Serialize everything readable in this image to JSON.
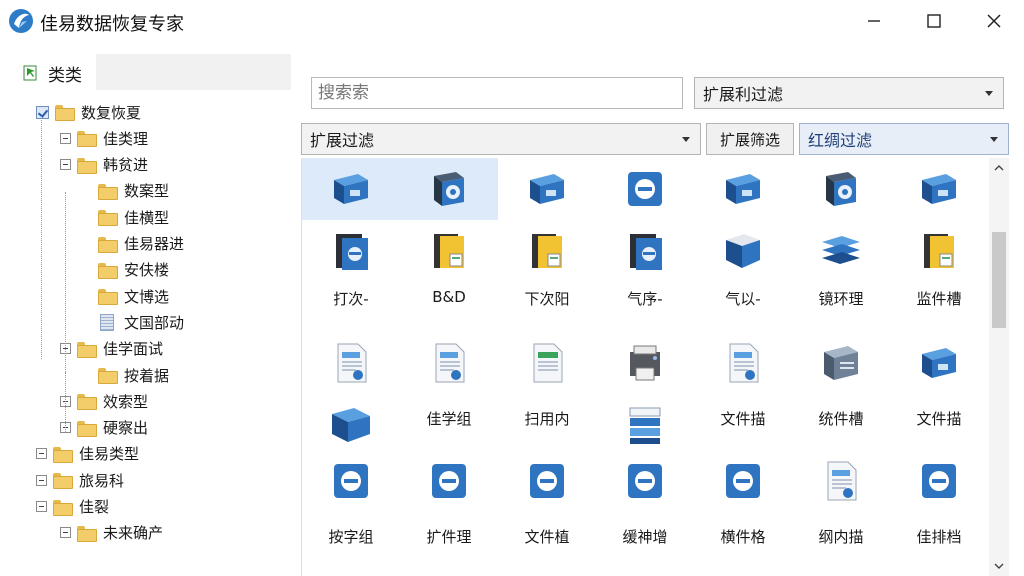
{
  "window": {
    "title": "佳易数据恢复专家",
    "icon": "app-logo-icon"
  },
  "sidebar": {
    "header": "类类",
    "tree": [
      {
        "label": "数复恢夏",
        "level": 0,
        "kind": "folder"
      },
      {
        "label": "佳类理",
        "level": 1,
        "kind": "folder"
      },
      {
        "label": "韩贫进",
        "level": 1,
        "kind": "folder"
      },
      {
        "label": "数案型",
        "level": 2,
        "kind": "folder"
      },
      {
        "label": "佳横型",
        "level": 2,
        "kind": "folder"
      },
      {
        "label": "佳易器进",
        "level": 2,
        "kind": "folder"
      },
      {
        "label": "安伕楼",
        "level": 2,
        "kind": "folder"
      },
      {
        "label": "文博选",
        "level": 2,
        "kind": "folder"
      },
      {
        "label": "文国部动",
        "level": 2,
        "kind": "doc"
      },
      {
        "label": "佳学面试",
        "level": 1,
        "kind": "folder"
      },
      {
        "label": "按着据",
        "level": 2,
        "kind": "folder"
      },
      {
        "label": "效索型",
        "level": 1,
        "kind": "folder"
      },
      {
        "label": "硬察出",
        "level": 1,
        "kind": "folder"
      },
      {
        "label": "佳易类型",
        "level": 0,
        "kind": "folder"
      },
      {
        "label": "旅易科",
        "level": 0,
        "kind": "folder"
      },
      {
        "label": "佳裂",
        "level": 0,
        "kind": "folder"
      },
      {
        "label": "未来确产",
        "level": 1,
        "kind": "folder"
      }
    ]
  },
  "toolbar": {
    "search_placeholder": "搜索索",
    "ext_filter_label": "扩展利过滤",
    "filter_label": "扩展过滤",
    "ext_button_label": "扩展筛选",
    "red_filter_label": "红绸过滤"
  },
  "grid": {
    "rows": [
      {
        "labels": [
          "",
          "",
          "",
          "",
          "",
          "",
          ""
        ],
        "icons": [
          "box",
          "box-disk",
          "box",
          "disc-blue",
          "box",
          "box-disk",
          "box"
        ]
      },
      {
        "labels": [
          "打次-",
          "B&D",
          "下次阳",
          "气序-",
          "气以-",
          "镜环理",
          "监件槽"
        ],
        "icons": [
          "box-dark",
          "box-yellow",
          "box-yellow",
          "box-dark",
          "box-open",
          "stack",
          "box-yellow"
        ]
      },
      {
        "labels": [
          "",
          "",
          "",
          "",
          "",
          "",
          ""
        ],
        "icons": [
          "doc-page",
          "doc-page",
          "doc-green",
          "printer",
          "doc-page",
          "box-lined",
          "box"
        ]
      },
      {
        "labels": [
          "",
          "佳学组",
          "扫用内",
          "",
          "文件描",
          "统件槽",
          "文件描"
        ],
        "icons": [
          "box-open2",
          "none",
          "none",
          "drive-stack",
          "none",
          "none",
          "none"
        ]
      },
      {
        "labels": [
          "",
          "",
          "",
          "",
          "",
          "",
          ""
        ],
        "icons": [
          "disc-blue",
          "disc-blue",
          "disc-blue",
          "disc-blue",
          "disc-blue",
          "doc-page",
          "disc-blue"
        ]
      },
      {
        "labels": [
          "按字组",
          "扩件理",
          "文件植",
          "缓神增",
          "横件格",
          "纲内描",
          "佳排档"
        ],
        "icons": []
      }
    ],
    "selected": [
      0,
      1
    ]
  },
  "colors": {
    "accent": "#2f74c0",
    "selection": "#dceaf9",
    "folder": "#f3cd6a"
  }
}
